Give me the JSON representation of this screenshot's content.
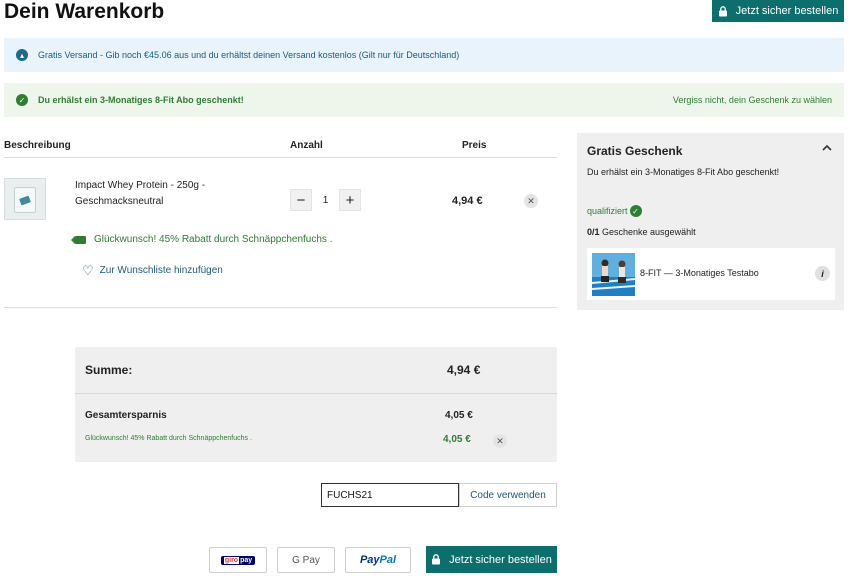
{
  "header": {
    "title": "Dein Warenkorb",
    "checkout_label": "Jetzt sicher bestellen"
  },
  "banners": {
    "shipping": "Gratis Versand - Gib noch €45.06 aus und du erhältst deinen Versand kostenlos (Gilt nur für Deutschland)",
    "gift_message": "Du erhälst ein 3-Monatiges 8-Fit Abo geschenkt!",
    "gift_link": "Vergiss nicht, dein Geschenk zu wählen"
  },
  "cart": {
    "columns": {
      "description": "Beschreibung",
      "quantity": "Anzahl",
      "price": "Preis"
    },
    "item": {
      "name": "Impact Whey Protein - 250g - Geschmacksneutral",
      "quantity": "1",
      "price": "4,94 €",
      "discount_text": "Glückwunsch! 45% Rabatt durch Schnäppchenfuchs .",
      "wishlist_label": "Zur Wunschliste hinzufügen"
    }
  },
  "summary": {
    "sum_label": "Summe:",
    "sum_value": "4,94 €",
    "savings_label": "Gesamtersparnis",
    "savings_value": "4,05 €",
    "promo_text": "Glückwunsch! 45% Rabatt durch Schnäppchenfuchs .",
    "promo_value": "4,05 €"
  },
  "promo_code": {
    "value": "FUCHS21",
    "button_label": "Code verwenden"
  },
  "payment": {
    "giropay_label": "pay",
    "giropay_prefix": "giro",
    "gpay_label": "G Pay",
    "paypal_pay": "Pay",
    "paypal_pal": "Pal",
    "checkout_label": "Jetzt sicher bestellen"
  },
  "gift_panel": {
    "title": "Gratis Geschenk",
    "description": "Du erhälst ein 3-Monatiges 8-Fit Abo geschenkt!",
    "qualified_label": "qualifiziert",
    "count_value": "0/1",
    "count_label": " Geschenke ausgewählt",
    "item_label": "8-FIT — 3-Monatiges Testabo",
    "info_glyph": "i"
  },
  "colors": {
    "primary": "#0d6e6e",
    "success": "#2e7d32",
    "info_bg": "#e8f3fb",
    "success_bg": "#eef6ec",
    "panel_bg": "#efefef"
  }
}
